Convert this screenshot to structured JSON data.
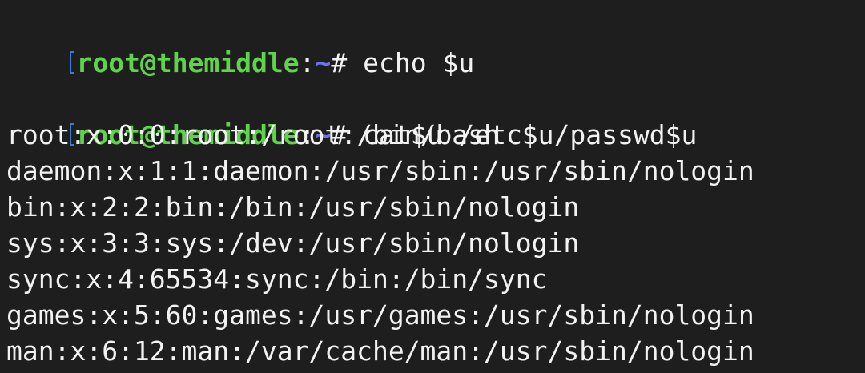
{
  "prompts": [
    {
      "user_host": "root@themiddle",
      "sep": ":",
      "path": "~",
      "symbol": "#",
      "command": " echo $u"
    },
    {
      "user_host": "root@themiddle",
      "sep": ":",
      "path": "~",
      "symbol": "#",
      "command": " cat$u /etc$u/passwd$u"
    }
  ],
  "output_lines": [
    "root:x:0:0:root:/root:/bin/bash",
    "daemon:x:1:1:daemon:/usr/sbin:/usr/sbin/nologin",
    "bin:x:2:2:bin:/bin:/usr/sbin/nologin",
    "sys:x:3:3:sys:/dev:/usr/sbin/nologin",
    "sync:x:4:65534:sync:/bin:/bin/sync",
    "games:x:5:60:games:/usr/games:/usr/sbin/nologin",
    "man:x:6:12:man:/var/cache/man:/usr/sbin/nologin"
  ],
  "colors": {
    "background": "#1e1e1e",
    "user_host": "#5fd44a",
    "path": "#6f6ff0",
    "text": "#f2f2f2"
  }
}
